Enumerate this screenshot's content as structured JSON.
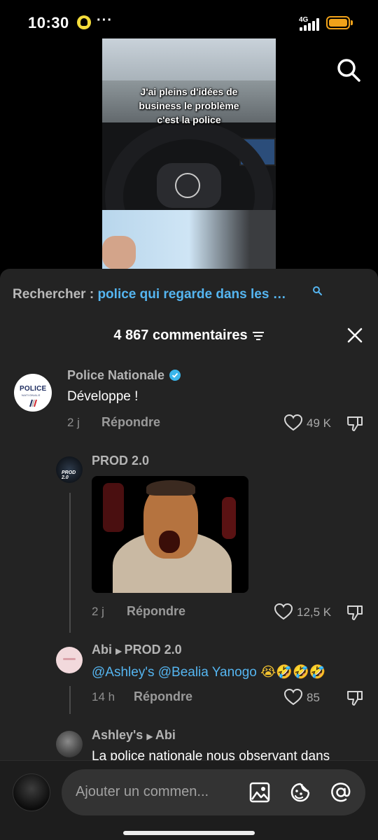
{
  "status": {
    "time": "10:30",
    "dots": "···",
    "network": "4G"
  },
  "video": {
    "caption": [
      "J'ai pleins d'idées de",
      "business le problème",
      "c'est la police"
    ]
  },
  "search": {
    "label": "Rechercher : ",
    "query": "police qui regarde dans les …"
  },
  "comments_header": {
    "title": "4 867 commentaires"
  },
  "comments": [
    {
      "username": "Police Nationale",
      "verified": true,
      "text": "Développe !",
      "age": "2 j",
      "reply": "Répondre",
      "likes": "49 K",
      "avatar_text": "POLICE",
      "avatar_subtext": "NATIONALE"
    },
    {
      "username": "PROD 2.0",
      "avatar_text": "PROD 2.0",
      "age": "2 j",
      "reply": "Répondre",
      "likes": "12,5 K",
      "has_gif": true
    },
    {
      "username": "Abi",
      "reply_to": "PROD 2.0",
      "mentions": [
        "@Ashley's",
        "@Bealia Yanogo"
      ],
      "emojis": "😭🤣🤣🤣",
      "age": "14 h",
      "reply": "Répondre",
      "likes": "85"
    },
    {
      "username": "Ashley's",
      "reply_to": "Abi",
      "text": "La police nationale nous observant dans"
    }
  ],
  "composer": {
    "placeholder": "Ajouter un commen..."
  },
  "colors": {
    "accent_blue": "#55b5f0",
    "sheet_bg": "#232323",
    "battery": "#f0a21a"
  }
}
